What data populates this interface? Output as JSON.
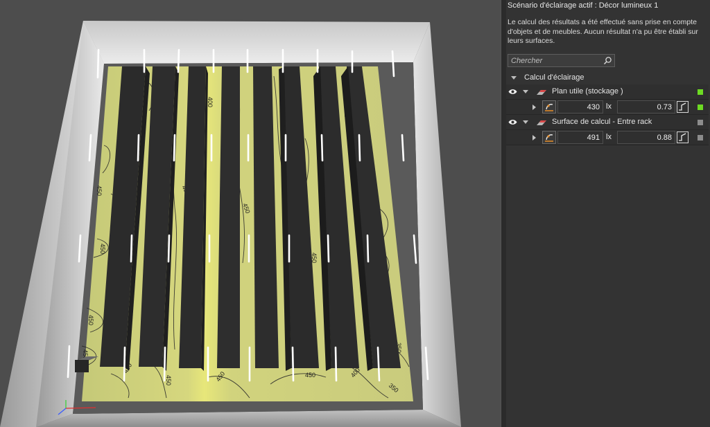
{
  "panel": {
    "scenario_title": "Scénario d'éclairage actif : Décor lumineux 1",
    "message": "Le calcul des résultats a été effectué sans prise en compte d'objets et de meubles. Aucun résultat n'a pu être établi sur leurs surfaces.",
    "search_placeholder": "Chercher",
    "section_label": "Calcul d'éclairage",
    "items": [
      {
        "label": "Plan utile (stockage )",
        "illuminance": "430",
        "unit": "lx",
        "uniformity": "0.73",
        "status_color": "#6ddb23"
      },
      {
        "label": "Surface de calcul - Entre rack",
        "illuminance": "491",
        "unit": "lx",
        "uniformity": "0.88",
        "status_color": "#8c8c8c"
      }
    ]
  },
  "viewport": {
    "contour_labels": [
      "450",
      "450",
      "450",
      "450",
      "450",
      "450",
      "450",
      "450",
      "400",
      "400",
      "350",
      "450",
      "450",
      "400",
      "350",
      "450"
    ]
  }
}
